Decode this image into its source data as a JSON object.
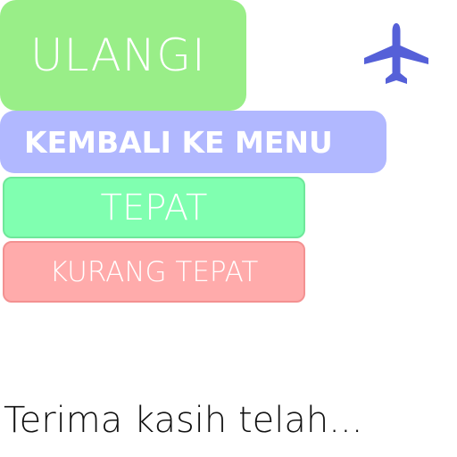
{
  "buttons": {
    "retry_label": "ULANGI",
    "back_to_menu_label": "KEMBALI KE MENU",
    "correct_label": "TEPAT",
    "less_correct_label": "KURANG TEPAT"
  },
  "message": {
    "thanks_text": "Terima kasih telah..."
  },
  "icons": {
    "plane": "airplane-icon"
  },
  "colors": {
    "retry_bg": "#99ee88",
    "back_bg": "#b1b8ff",
    "correct_bg": "#80ffb0",
    "less_correct_bg": "#ffabab",
    "plane": "#5560d8"
  }
}
